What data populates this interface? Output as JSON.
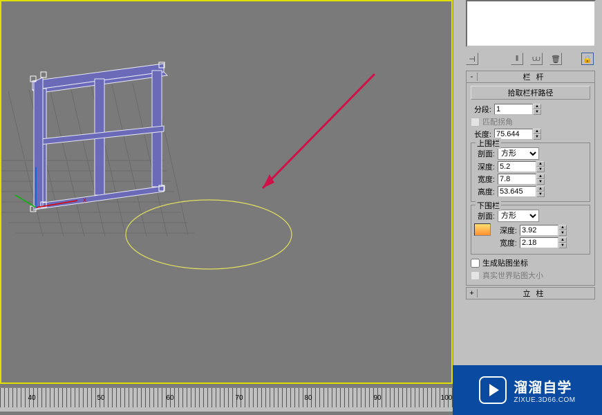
{
  "ruler": {
    "ticks": [
      "40",
      "50",
      "60",
      "70",
      "80",
      "90",
      "100"
    ]
  },
  "rollouts": {
    "railing": {
      "title": "栏杆",
      "toggle": "-",
      "pick_path": "拾取栏杆路径",
      "segments_label": "分段:",
      "segments": "1",
      "match_corners": "匹配拐角",
      "length_label": "长度:",
      "length": "75.644"
    },
    "top_rail": {
      "title": "上围栏",
      "profile_label": "剖面:",
      "profile": "方形",
      "depth_label": "深度:",
      "depth": "5.2",
      "width_label": "宽度:",
      "width": "7.8",
      "height_label": "高度:",
      "height": "53.645"
    },
    "bottom_rail": {
      "title": "下围栏",
      "profile_label": "剖面:",
      "profile": "方形",
      "depth_label": "深度:",
      "depth": "3.92",
      "width_label": "宽度:",
      "width": "2.18"
    },
    "gen_map": "生成贴图坐标",
    "real_world": "真实世界贴图大小",
    "posts": {
      "title": "立柱",
      "toggle": "+"
    }
  },
  "watermark": {
    "main": "溜溜自学",
    "sub": "ZIXUE.3D66.COM"
  }
}
